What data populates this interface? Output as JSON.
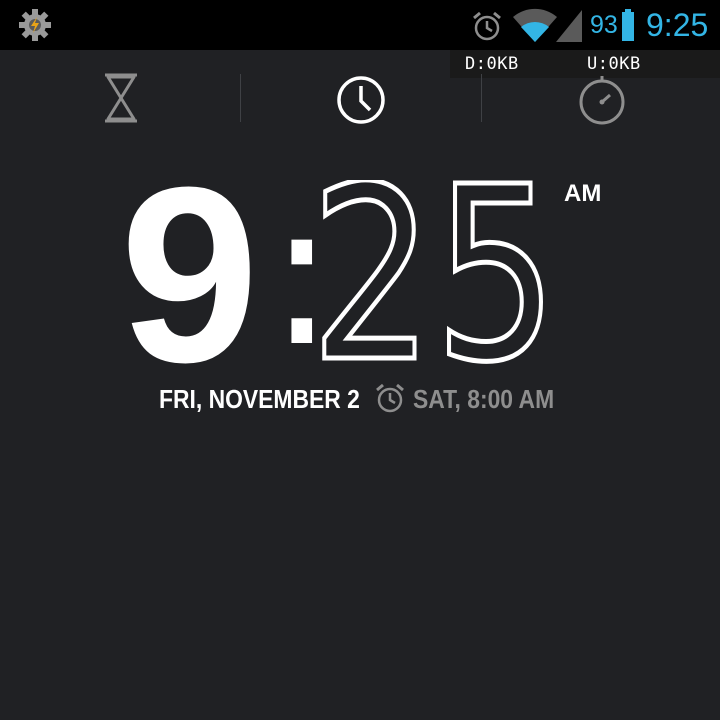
{
  "status_bar": {
    "app_icon": "tasker-gear-icon",
    "alarm_icon": "alarm-clock-icon",
    "wifi_icon": "wifi-icon",
    "signal_icon": "cell-signal-icon",
    "battery_level": "93",
    "battery_icon": "battery-icon",
    "time": "9:25",
    "accent_color": "#33b5e5"
  },
  "netspeed": {
    "download": "D:0KB",
    "upload": "U:0KB"
  },
  "tabs": [
    {
      "name": "timer",
      "icon": "hourglass-icon",
      "selected": false
    },
    {
      "name": "clock",
      "icon": "clock-icon",
      "selected": true
    },
    {
      "name": "stopwatch",
      "icon": "stopwatch-icon",
      "selected": false
    }
  ],
  "clock": {
    "hour": "9",
    "separator": ":",
    "minutes": "25",
    "ampm": "AM"
  },
  "date_row": {
    "date": "FRI, NOVEMBER 2",
    "next_alarm_icon": "alarm-clock-icon",
    "next_alarm": "SAT, 8:00 AM"
  },
  "colors": {
    "background": "#202124",
    "status_bar": "#000000",
    "secondary_text": "#8e8e8e"
  }
}
